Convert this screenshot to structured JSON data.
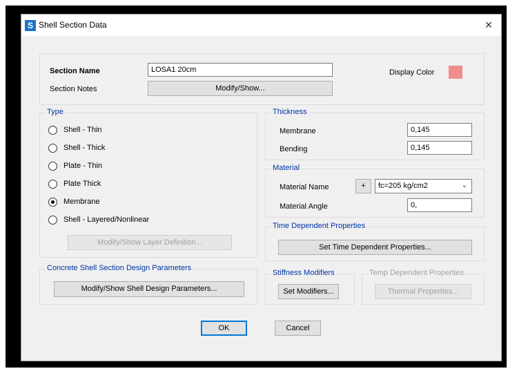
{
  "window": {
    "title": "Shell Section Data",
    "app_icon_letter": "S",
    "close_glyph": "✕"
  },
  "section": {
    "name_label": "Section Name",
    "name_value": "LOSA1 20cm",
    "notes_label": "Section Notes",
    "notes_button": "Modify/Show...",
    "display_color_label": "Display Color",
    "display_color": "#f08c8c"
  },
  "type": {
    "title": "Type",
    "options": [
      {
        "label": "Shell - Thin",
        "checked": false
      },
      {
        "label": "Shell - Thick",
        "checked": false
      },
      {
        "label": "Plate - Thin",
        "checked": false
      },
      {
        "label": "Plate Thick",
        "checked": false
      },
      {
        "label": "Membrane",
        "checked": true
      },
      {
        "label": "Shell - Layered/Nonlinear",
        "checked": false
      }
    ],
    "layer_button": "Modify/Show Layer Definition..."
  },
  "thickness": {
    "title": "Thickness",
    "membrane_label": "Membrane",
    "membrane_value": "0,145",
    "bending_label": "Bending",
    "bending_value": "0,145"
  },
  "material": {
    "title": "Material",
    "name_label": "Material Name",
    "add_button": "+",
    "name_value": "fc=205 kg/cm2",
    "angle_label": "Material Angle",
    "angle_value": "0,"
  },
  "time_dependent": {
    "title": "Time Dependent Properties",
    "button": "Set Time Dependent Properties..."
  },
  "design": {
    "title": "Concrete Shell Section Design Parameters",
    "button": "Modify/Show Shell Design Parameters..."
  },
  "stiffness": {
    "title": "Stiffness Modifiers",
    "button": "Set Modifiers..."
  },
  "temp": {
    "title": "Temp Dependent Properties",
    "button": "Thermal Properties..."
  },
  "footer": {
    "ok": "OK",
    "cancel": "Cancel"
  }
}
